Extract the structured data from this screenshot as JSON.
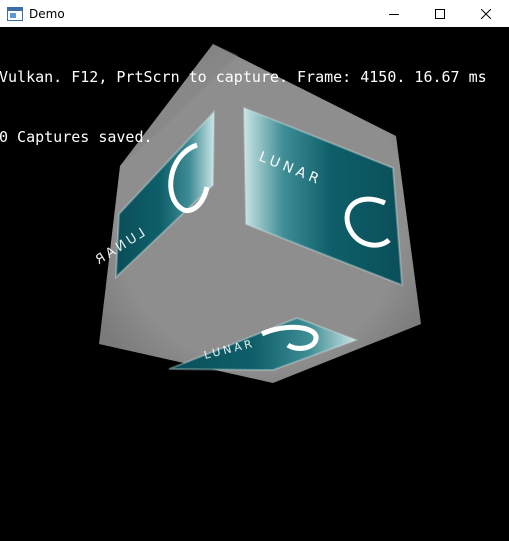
{
  "window": {
    "title": "Demo",
    "app_icon": "app-window-icon",
    "controls": {
      "minimize_icon": "minimize-icon",
      "maximize_icon": "maximize-icon",
      "close_icon": "close-icon"
    }
  },
  "overlay": {
    "line1": "Vulkan. F12, PrtScrn to capture. Frame: 4150. 16.67 ms",
    "line2": "0 Captures saved."
  },
  "scene": {
    "object": "rotating textured cube",
    "logo_text": "LUNAR",
    "logo_glyph": "C",
    "colors": {
      "background": "#000000",
      "cube_face": "#8a8a8a",
      "logo_teal_dark": "#0b5560",
      "logo_teal_light": "#d8ecec",
      "text": "#ffffff"
    }
  }
}
